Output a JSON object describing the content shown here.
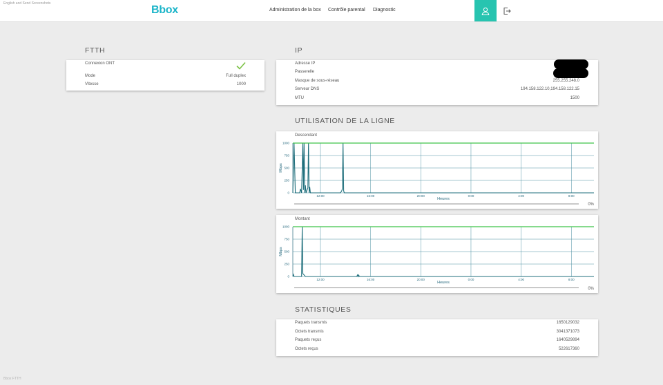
{
  "watermark": "English and Send Screenshots",
  "footer_mark": "Bbox FTTH",
  "header": {
    "logo": "Bbox",
    "nav": [
      "Administration de la box",
      "Contrôle parental",
      "Diagnostic"
    ],
    "account_icon": "user-icon",
    "logout_icon": "logout-icon",
    "accent_color": "#27c4b0",
    "logo_color": "#1cb5c9"
  },
  "ftth": {
    "title": "FTTH",
    "connexion_label": "Connexion ONT",
    "connexion_status_icon": "check-icon",
    "status_color": "#7ac143",
    "mode_label": "Mode",
    "mode_value": "Full duplex",
    "vitesse_label": "Vitesse",
    "vitesse_value": "1000"
  },
  "ip": {
    "title": "IP",
    "rows": [
      {
        "label": "Adresse IP",
        "value": ""
      },
      {
        "label": "Passerelle",
        "value": ""
      },
      {
        "label": "Masque de sous-réseau",
        "value": "255.255.248.0"
      },
      {
        "label": "Serveur DNS",
        "value": "194.158.122.10,194.158.122.15"
      },
      {
        "label": "MTU",
        "value": "1500"
      }
    ]
  },
  "usage": {
    "title": "UTILISATION DE LA LIGNE",
    "charts": [
      {
        "label": "Descendant",
        "percent": "0%"
      },
      {
        "label": "Montant",
        "percent": "0%"
      }
    ]
  },
  "chart_data": [
    {
      "type": "line",
      "title": "Descendant",
      "xlabel": "Heures",
      "ylabel": "Mbps",
      "yticks": [
        0,
        250,
        500,
        750,
        1000
      ],
      "ylim": [
        0,
        1000
      ],
      "xticks": [
        "12:00",
        "16:00",
        "20:00",
        "0:00",
        "4:00",
        "8:00"
      ],
      "xlim": [
        9.8,
        33.8
      ],
      "grid": true,
      "colors": {
        "line": "#1f6f7c",
        "max_line": "#3ec449"
      },
      "series": [
        {
          "values": [
            [
              9.8,
              0
            ],
            [
              9.9,
              1000
            ],
            [
              10.0,
              0
            ],
            [
              10.2,
              0
            ],
            [
              10.35,
              0
            ],
            [
              10.4,
              80
            ],
            [
              10.5,
              0
            ],
            [
              10.6,
              1000
            ],
            [
              10.65,
              60
            ],
            [
              10.7,
              1000
            ],
            [
              10.75,
              0
            ],
            [
              10.8,
              150
            ],
            [
              10.85,
              0
            ],
            [
              11.0,
              100
            ],
            [
              11.05,
              1000
            ],
            [
              11.1,
              0
            ],
            [
              11.15,
              120
            ],
            [
              11.2,
              0
            ],
            [
              13.5,
              0
            ],
            [
              13.6,
              0
            ],
            [
              13.7,
              40
            ],
            [
              13.75,
              80
            ],
            [
              13.8,
              1000
            ],
            [
              13.85,
              40
            ],
            [
              13.9,
              0
            ],
            [
              33.8,
              0
            ]
          ]
        },
        {
          "values": [
            [
              9.8,
              1000
            ],
            [
              33.8,
              1000
            ]
          ]
        }
      ]
    },
    {
      "type": "line",
      "title": "Montant",
      "xlabel": "Heures",
      "ylabel": "Mbps",
      "yticks": [
        0,
        250,
        500,
        750,
        1000
      ],
      "ylim": [
        0,
        1000
      ],
      "xticks": [
        "12:00",
        "16:00",
        "20:00",
        "0:00",
        "4:00",
        "8:00"
      ],
      "xlim": [
        9.8,
        33.8
      ],
      "grid": true,
      "colors": {
        "line": "#1f6f7c",
        "max_line": "#3ec449"
      },
      "series": [
        {
          "values": [
            [
              9.8,
              0
            ],
            [
              9.85,
              40
            ],
            [
              9.9,
              0
            ],
            [
              10.5,
              0
            ],
            [
              10.55,
              1000
            ],
            [
              10.6,
              60
            ],
            [
              10.7,
              30
            ],
            [
              10.8,
              0
            ],
            [
              14.9,
              0
            ],
            [
              14.95,
              30
            ],
            [
              15.0,
              0
            ],
            [
              15.05,
              30
            ],
            [
              15.1,
              0
            ],
            [
              33.8,
              0
            ]
          ]
        },
        {
          "values": [
            [
              9.8,
              1000
            ],
            [
              33.8,
              1000
            ]
          ]
        }
      ]
    }
  ],
  "stats": {
    "title": "STATISTIQUES",
    "rows": [
      {
        "label": "Paquets transmis",
        "value": "1650129032"
      },
      {
        "label": "Octets transmis",
        "value": "3041371073"
      },
      {
        "label": "Paquets reçus",
        "value": "1640529894"
      },
      {
        "label": "Octets reçus",
        "value": "522617360"
      }
    ]
  }
}
